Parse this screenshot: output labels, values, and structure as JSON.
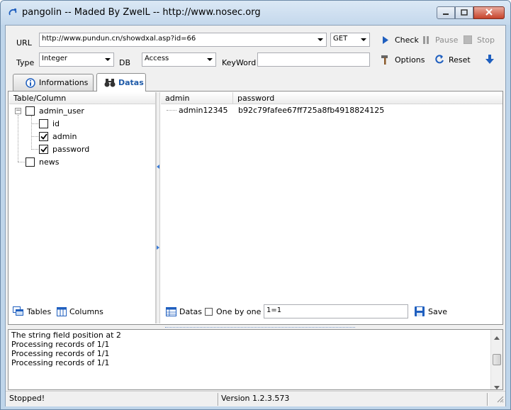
{
  "window": {
    "title": "pangolin -- Maded By ZwelL -- http://www.nosec.org"
  },
  "toolbar": {
    "url_label": "URL",
    "url_value": "http://www.pundun.cn/showdxal.asp?id=66",
    "method_value": "GET",
    "check_label": "Check",
    "pause_label": "Pause",
    "stop_label": "Stop",
    "type_label": "Type",
    "type_value": "Integer",
    "db_label": "DB",
    "db_value": "Access",
    "keyword_label": "KeyWord",
    "keyword_value": "",
    "options_label": "Options",
    "reset_label": "Reset"
  },
  "tabs": [
    {
      "label": "Informations",
      "icon": "info-icon",
      "active": false
    },
    {
      "label": "Datas",
      "icon": "binoculars-icon",
      "active": true
    }
  ],
  "tree": {
    "header": "Table/Column",
    "tables": [
      {
        "name": "admin_user",
        "checked": false,
        "columns": [
          {
            "name": "id",
            "checked": false
          },
          {
            "name": "admin",
            "checked": true
          },
          {
            "name": "password",
            "checked": true
          }
        ]
      },
      {
        "name": "news",
        "checked": false,
        "columns": []
      }
    ],
    "tables_button": "Tables",
    "columns_button": "Columns"
  },
  "grid": {
    "columns": [
      "admin",
      "password"
    ],
    "rows": [
      [
        "admin12345",
        "b92c79fafee67ff725a8fb4918824125"
      ]
    ],
    "datas_button": "Datas",
    "one_by_one_label": "One by one",
    "condition_value": "1=1",
    "save_button": "Save"
  },
  "log": {
    "lines": [
      "The string field position at 2",
      "Processing records of 1/1",
      "Processing records of 1/1",
      "Processing records of 1/1"
    ]
  },
  "status": {
    "state": "Stopped!",
    "version": "Version  1.2.3.573"
  },
  "colors": {
    "accent_blue": "#1f5fbf",
    "tab_active_text": "#1e5aa8",
    "title_gradient_top": "#dbe8f5",
    "close_red": "#c7432b"
  }
}
